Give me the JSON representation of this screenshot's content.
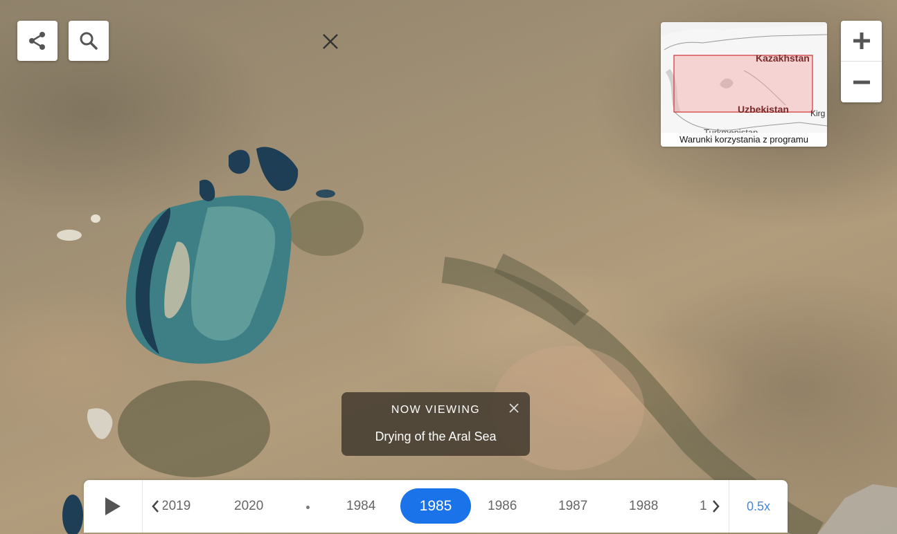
{
  "map": {
    "controls": {
      "share_icon": "share-icon",
      "search_icon": "search-icon",
      "close_icon": "close-icon"
    },
    "minimap": {
      "labels": {
        "kazakhstan": "Kazakhstan",
        "uzbekistan": "Uzbekistan",
        "kirg": "Kirg",
        "turkmenistan": "Turkmenistan"
      },
      "terms_link": "Warunki korzystania z programu",
      "highlight_color": "#f4b6b6",
      "highlight_border": "#cc3333"
    },
    "zoom": {
      "in_icon": "plus-icon",
      "out_icon": "minus-icon"
    }
  },
  "now_viewing": {
    "heading": "NOW VIEWING",
    "title": "Drying of the Aral Sea"
  },
  "timeline": {
    "years_left": [
      "2019",
      "2020"
    ],
    "years_right": [
      "1984",
      "1985",
      "1986",
      "1987",
      "1988",
      "1"
    ],
    "selected_year": "1985",
    "speed": "0.5x",
    "accent_color": "#1a73e8"
  }
}
